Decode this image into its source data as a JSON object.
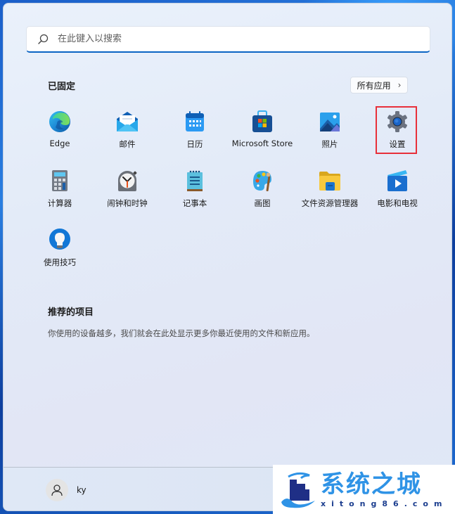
{
  "search": {
    "placeholder": "在此键入以搜索",
    "value": ""
  },
  "pinned": {
    "title": "已固定",
    "all_apps_label": "所有应用",
    "apps": [
      {
        "label": "Edge",
        "icon": "edge-icon"
      },
      {
        "label": "邮件",
        "icon": "mail-icon"
      },
      {
        "label": "日历",
        "icon": "calendar-icon"
      },
      {
        "label": "Microsoft Store",
        "icon": "store-icon"
      },
      {
        "label": "照片",
        "icon": "photos-icon"
      },
      {
        "label": "设置",
        "icon": "settings-gear-icon",
        "highlighted": true
      },
      {
        "label": "计算器",
        "icon": "calculator-icon"
      },
      {
        "label": "闹钟和时钟",
        "icon": "alarm-clock-icon"
      },
      {
        "label": "记事本",
        "icon": "notepad-icon"
      },
      {
        "label": "画图",
        "icon": "paint-palette-icon"
      },
      {
        "label": "文件资源管理器",
        "icon": "folder-icon"
      },
      {
        "label": "电影和电视",
        "icon": "movies-play-icon"
      },
      {
        "label": "使用技巧",
        "icon": "tips-lightbulb-icon"
      }
    ]
  },
  "recommended": {
    "title": "推荐的项目",
    "empty_text": "你使用的设备越多，我们就会在此处显示更多你最近使用的文件和新应用。"
  },
  "footer": {
    "user_name": "ky"
  },
  "watermark": {
    "cn": "系统之城",
    "en": "xitong86.com"
  },
  "colors": {
    "accent": "#0a64c4",
    "highlight_border": "#e8303a"
  }
}
